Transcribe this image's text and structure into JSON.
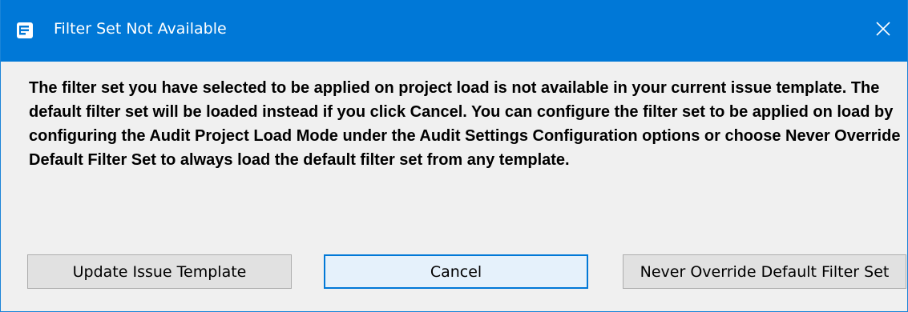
{
  "dialog": {
    "title": "Filter Set Not Available",
    "message": "The filter set you have selected to be applied on project load is not available in your current issue template. The default filter set will be loaded instead if you click Cancel. You can configure the filter set to be applied on load by configuring the Audit Project Load Mode under the Audit Settings Configuration options or choose Never Override Default Filter Set to always load the default filter set from any template."
  },
  "icons": {
    "app": "app-window-icon",
    "close": "close-icon"
  },
  "colors": {
    "titlebar": "#0078d7",
    "focus_border": "#0078d7",
    "button_bg": "#e1e1e1",
    "dialog_bg": "#f0f0f0"
  },
  "buttons": {
    "update_label": "Update Issue Template",
    "cancel_label": "Cancel",
    "never_label": "Never Override Default Filter Set"
  }
}
